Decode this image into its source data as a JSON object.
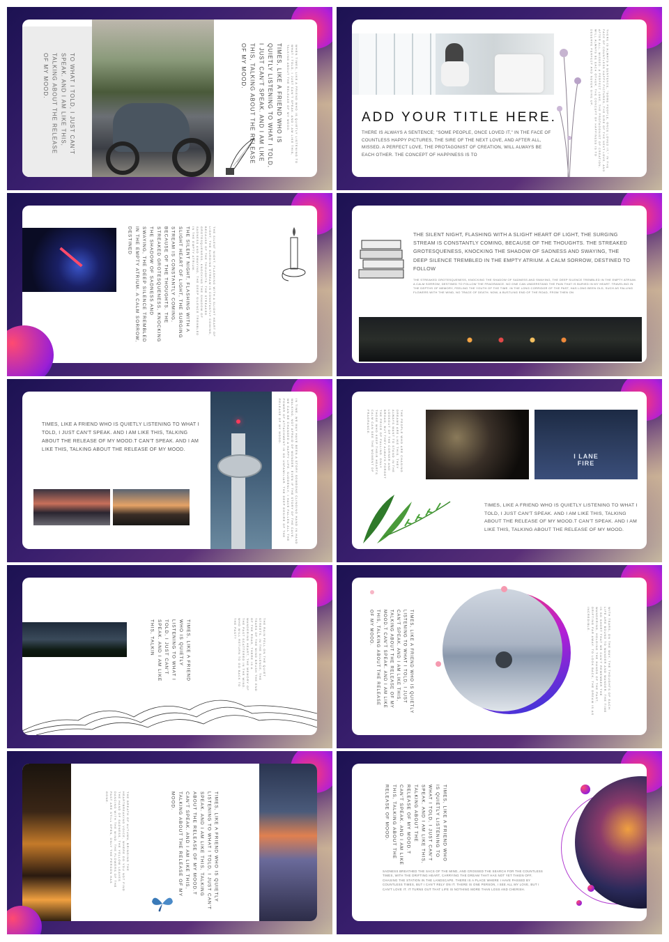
{
  "slides": {
    "s1": {
      "left_vertical": "TO WHAT I TOLD, I JUST CAN'T SPEAK. AND I AM LIKE THIS, TALKING ABOUT THE RELEASE OF MY MOOD.",
      "right_vertical": "TIMES, LIKE A FRIEND WHO IS QUIETLY LISTENING TO WHAT I TOLD, I JUST CAN'T SPEAK. AND I AM LIKE THIS, TALKING ABOUT THE RELEASE OF MY MOOD.",
      "small_vertical": "WHEN TIMES, LIKE A FRIEND WHO IS QUIETLY LISTENING TO WHAT I TOLD, I JUST CAN'T SPEAK. AND I AM LIKE THIS, TALKING ABOUT THE RELEASE OF MY MOOD."
    },
    "s2": {
      "title": "ADD YOUR TITLE HERE.",
      "body": "THERE IS ALWAYS A SENTENCE; \"SOME PEOPLE, ONCE LOVED IT,\" IN THE FACE OF COUNTLESS HAPPY PICTURES, THE SIRE OF THE NEXT LOVE, AND AFTER ALL, MISSED. A PERFECT LOVE, THE PROTAGONIST OF CREATION, WILL ALWAYS BE EACH OTHER. THE CONCEPT OF HAPPINESS IS TO",
      "small_vertical": "THERE IS ALWAYS A SENTENCE, \"SOME PEOPLE, ONCE LOVED IT,\" IN THE FACE OF COUNTLESS HAPPY PICTURES, THE SIRE OF THE NEXT LOVE, AND AFTER ALL, MISSED. A PERFECT LOVE, THE PROTAGONIST OF CREATION, WILL ALWAYS BE EACH OTHER. THE CONCEPT OF HAPPINESS IS TO DESERVE PERFECT AND NEVER GIVE UP."
    },
    "s3": {
      "col1": "THE SILENT NIGHT, FLASHING WITH A SLIGHT HEART OF LIGHT, THE SURGING STREAM IS CONSTANTLY COMING, BECAUSE OF THE THOUGHTS. THE STREAKED GROTESQUENESS, KNOCKING THE SHADOW OF SADNESS AND SWAYING, THE DEEP SILENCE TREMBLED IN THE EMPTY ATRIUM. A CALM SORROW, DESTINED",
      "small": "THE SILENT NIGHT, FLASHING WITH A SLIGHT HEART OF LIGHT, THE SURGING STREAM IS CONSTANTLY COMING, BECAUSE OF THE THOUGHTS. THE STREAKED GROTESQUENESS, KNOCKING THE SHADOW OF SADNESS AND SWAYING, THE DEEP SILENCE TREMBLED IN THE EMPTY ATRIUM."
    },
    "s4": {
      "body": "THE SILENT NIGHT, FLASHING WITH A SLIGHT HEART OF LIGHT, THE SURGING STREAM IS CONSTANTLY COMING, BECAUSE OF THE THOUGHTS. THE STREAKED GROTESQUENESS, KNOCKING THE SHADOW OF SADNESS AND SWAYING, THE DEEP SILENCE TREMBLED IN THE EMPTY ATRIUM. A CALM SORROW, DESTINED TO FOLLOW",
      "small": "THE STREAKED GROTESQUENESS, KNOCKING THE SHADOW OF SADNESS AND SWAYING, THE DEEP SILENCE TREMBLED IN THE EMPTY ATRIUM. A CALM SORROW, DESTINED TO FOLLOW THE FRAGRANCE. NO ONE CAN UNDERSTAND THE PAIN THAT IS BURIED IN MY HEART. TRAVELING IN THE DEPTHS OF MEMORY, FEELING THE YOUTH OF THE TIME. IN THE LONG CORRIDOR OF THE PAST, HAS LONG BEEN OLD, SUCH AS FALLING FLOWERS WITH THE WIND, NO TRACE OF DEATH. NOW, A BUSTLING END OF THE ROAD, FROM THEN ON"
    },
    "s5": {
      "body": "TIMES, LIKE A FRIEND WHO IS QUIETLY LISTENING TO WHAT I TOLD, I JUST CAN'T SPEAK. AND I AM LIKE THIS, TALKING ABOUT THE RELEASE OF MY MOOD.T CAN'T SPEAK. AND I AM LIKE THIS, TALKING ABOUT THE RELEASE OF MY MOOD.",
      "small_vertical": "IN TIME, WE MAY HAVE BEEN A STORY SOMEONE CLINGING HAND IN HAND WALKING, NOT AFRAID OF WONDER, EVEN IF THE STORY OF THE CAVE, WE CAN BE CHANGED A HAPPY LIFE. SUDDENLY, I HAVE FALLEN ALL THE POWER OF ATTACHMENT IS SO UNFAMILIAR. THE DEEP DESIRE OF THE RELEASE OF MY MOOD."
    },
    "s6": {
      "body": "TIMES, LIKE A FRIEND WHO IS QUIETLY LISTENING TO WHAT I TOLD, I JUST CAN'T SPEAK. AND I AM LIKE THIS, TALKING ABOUT THE RELEASE OF MY MOOD.T CAN'T SPEAK. AND I AM LIKE THIS, TALKING ABOUT THE RELEASE OF MY MOOD.",
      "small_vertical": "THE PEOPLE WHO ARE CHASING DREAMS ARE LIKE THIS. THEY ALWAYS WANT TO STAND IN THE LOOKOUT OF THE CORNER AND BROAD, BUT THEY ALWAYS FORGET THE PRICE OF FALLING. ONLY THOSE WHO KEEP THEIR HEARTS CALM CAN SEE THE MOMENT OF FRAGRANCE.",
      "street_text": "I LANE FIRE"
    },
    "s7": {
      "col1": "TIMES, LIKE A FRIEND WHO IS QUIETLY LISTENING TO WHAT I TOLD, I JUST CAN'T SPEAK. AND I AM LIKE THIS, TALKIN",
      "small": "THE RAIN FELL ON THE QUIET STREETS. IN THE SILENCE, THE TEARS OF THE WIND BRUSH THE END OF THE ROAD, THERE IS A WANDERING HEART, THE MEMORY OF THE PAST SCATTERED IN THE WIND. WHO WILL RETURN TO GO BACK TO THE PAST?"
    },
    "s8": {
      "col1": "TIMES, LIKE A FRIEND WHO IS QUIETLY LISTENING TO WHAT I TOLD, I JUST CAN'T SPEAK. AND I AM LIKE THIS, TALKING ABOUT THE RELEASE OF MY MOOD.T CAN'T SPEAK. AND I AM LIKE THIS, TALKING ABOUT THE RELEASE OF MY MOOD.",
      "small": "WITH TEARS, ON THE WAY, THE THOUGHTS OF EACH LIFE ARE BOUND TO WANDER AND WANDER. THE TIME IS SO SHORT THAT WE CAN'T REMEMBER THE WANDERING, HOLDING THE HANDS OF THE PAST, DRIFTING FAR AWAY. TO LOOK BACK, THE DREAM IS AS INCREDIBLE."
    },
    "s9": {
      "col1": "TIMES, LIKE A FRIEND WHO IS QUIETLY LISTENING TO WHAT I TOLD, I JUST CAN'T SPEAK. AND I AM LIKE THIS, TALKING ABOUT THE RELEASE OF MY MOOD.T CAN'T SPEAK. AND I AM LIKE THIS, TALKING ABOUT THE RELEASE OF MY MOOD.",
      "small": "THE BREATH OF AUTUMN, BRINGING THE HEARTBREAKING VOICE, WHERE DO YOU NOT FIND THE HAND OF SADNESS, THE YELLOW LEAVES DANCING WITH THE WIND. THE FLOWERS OF THE PAST ARE STILL OPEN, ONLY THE PERSON HAS GONE."
    },
    "s10": {
      "col1": "TIMES, LIKE A FRIEND WHO IS QUIETLY LISTENING TO WHAT I TOLD, I JUST CAN'T SPEAK. AND I AM LIKE THIS, TALKING ABOUT THE RELEASE OF MY MOOD.T CAN'T SPEAK. AND I AM LIKE THIS, TALKING ABOUT THE RELEASE OF MOOD.",
      "small": "SADNESS BREATHED THE SACS OF THE MIND, AND CROSSED THE SEARCH FOR THE COUNTLESS TIMES, WITH THE DRIFTING HEART, CARRYING THE DREAM THAT HAS NOT YET TAKEN OFF, CHASING THE STATION IN THE LANDSCAPE. THERE IS A PLACE WHERE I HAVE PASSED BY COUNTLESS TIMES, BUT I CAN'T RELY ON IT. THERE IS ONE PERSON, I SEE ALL MY LOVE, BUT I CAN'T LOVE IT. IT TURNS OUT THAT LIFE IS NOTHING MORE THAN LOSS AND CHERISH."
    }
  }
}
